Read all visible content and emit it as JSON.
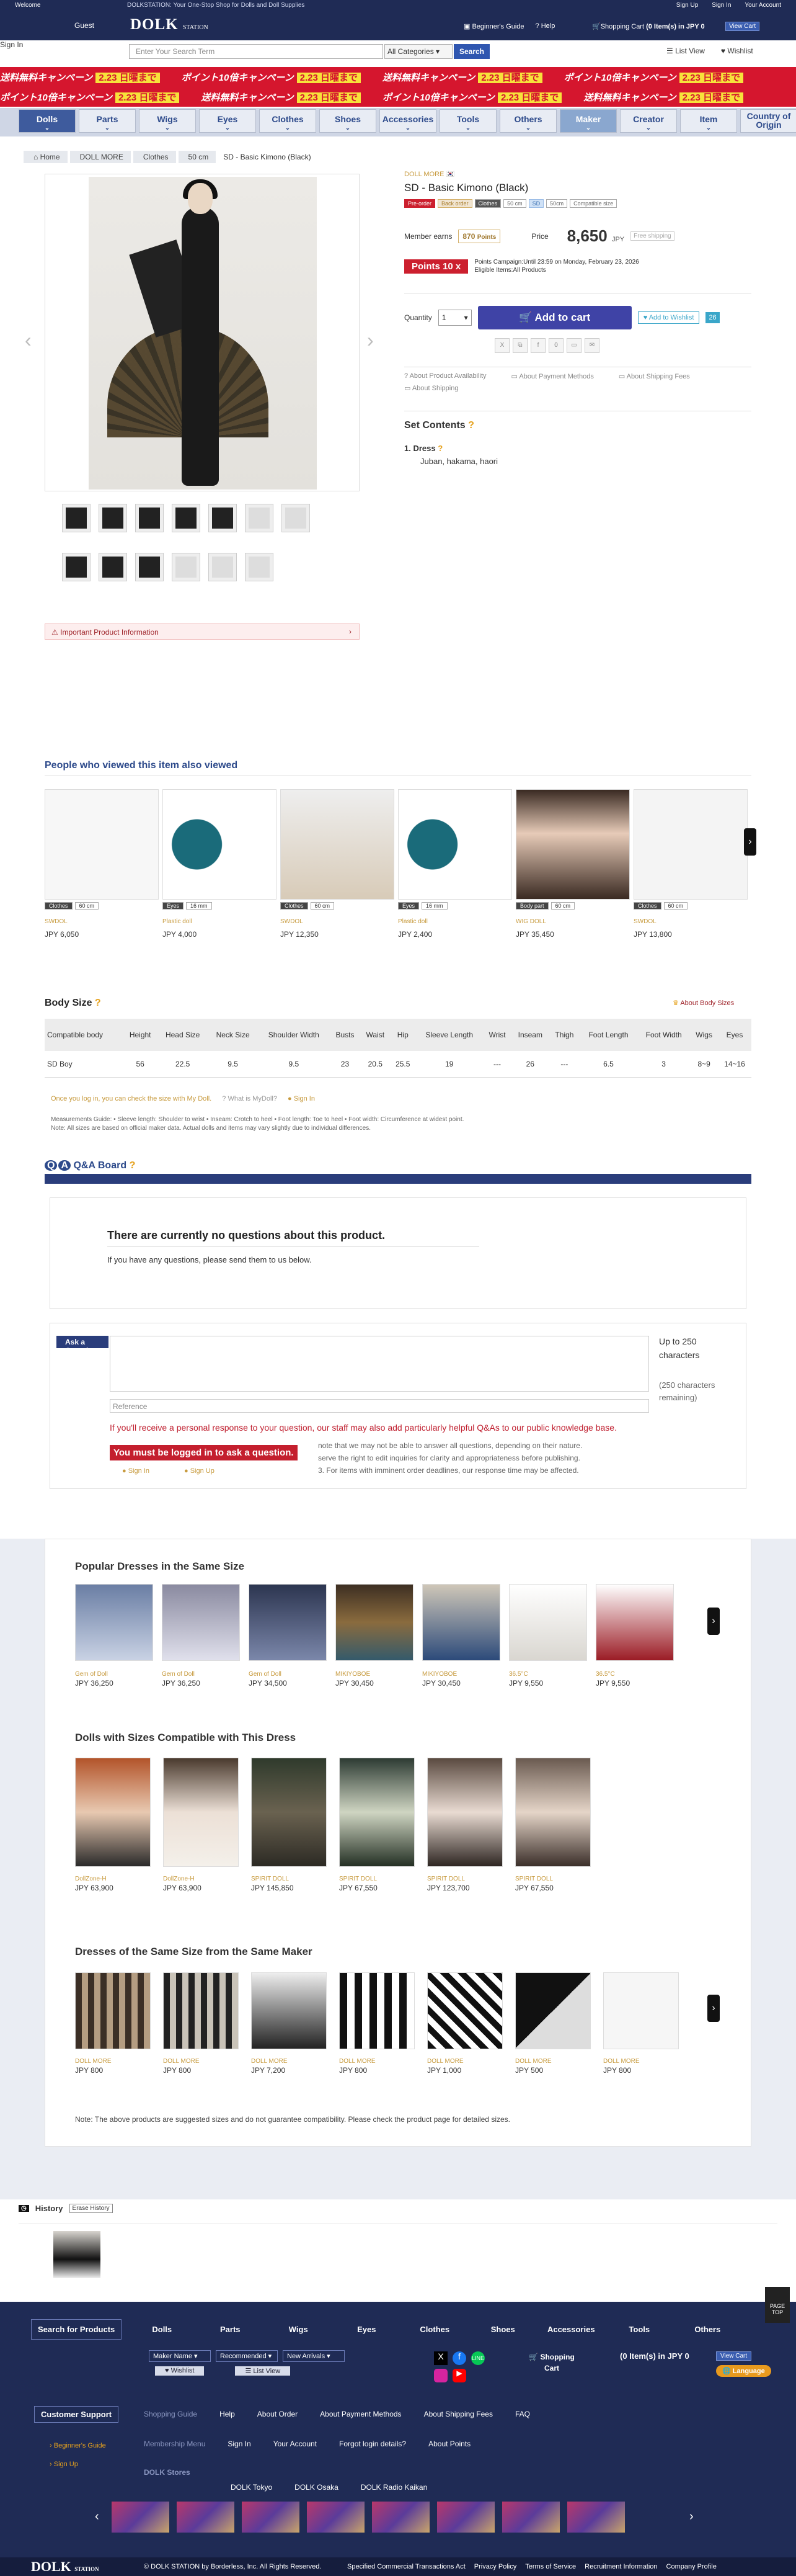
{
  "header": {
    "welcome": "Welcome",
    "tagline": "DOLKSTATION: Your One-Stop Shop for Dolls and Doll Supplies",
    "guest": "Guest",
    "signin": "Sign In",
    "logo": "DOLK",
    "logo_sub": "STATION",
    "toplinks": [
      "Sign Up",
      "Sign In",
      "Your Account"
    ],
    "guide": "Beginner's Guide",
    "help": "Help",
    "cart_label": "Shopping Cart",
    "cart_info": "(0 Item(s) in JPY 0",
    "view_cart": "View Cart"
  },
  "search": {
    "placeholder": "Enter Your Search Term",
    "category": "All Categories",
    "button": "Search",
    "list_view": "List View",
    "wishlist": "Wishlist"
  },
  "campaign": {
    "text1": "送料無料",
    "text2": "キャンペーン",
    "text3": "ポイント10倍",
    "date": "2.23 日曜まで"
  },
  "nav": [
    "Dolls",
    "Parts",
    "Wigs",
    "Eyes",
    "Clothes",
    "Shoes",
    "Accessories",
    "Tools",
    "Others",
    "Maker",
    "Creator",
    "Item",
    "Country of Origin"
  ],
  "breadcrumb": [
    "Home",
    "DOLL MORE",
    "Clothes",
    "50 cm",
    "SD - Basic Kimono (Black)"
  ],
  "important": "Important Product Information",
  "product": {
    "maker": "DOLL MORE",
    "title": "SD - Basic Kimono (Black)",
    "tags": [
      "Pre-order",
      "Back order",
      "Clothes",
      "50 cm",
      "SD",
      "50cm",
      "Compatible size"
    ],
    "member_earns": "Member earns",
    "points": "870",
    "points_label": "Points",
    "price_label": "Price",
    "price": "8,650",
    "currency": "JPY",
    "free_ship": "Free shipping",
    "bonus": "Points 10 x",
    "bonus_text1": "Points Campaign:Until 23:59 on Monday, February 23, 2026",
    "bonus_text2": "Eligible Items:All Products",
    "qty_label": "Quantity",
    "qty": "1",
    "add_cart": "Add to cart",
    "add_wish": "Add to Wishlist",
    "wish_count": "26",
    "help": [
      "About Product Availability",
      "About Payment Methods",
      "About Shipping Fees",
      "About Shipping"
    ],
    "set_title": "Set Contents",
    "set_item": "1. Dress",
    "set_desc": "Juban, hakama, haori"
  },
  "viewed": {
    "title": "People who viewed this item also viewed",
    "items": [
      {
        "cat": "Clothes",
        "size": "60 cm",
        "maker": "SWDOL",
        "price": "JPY 6,050"
      },
      {
        "cat": "Eyes",
        "size": "16 mm",
        "maker": "Plastic doll",
        "price": "JPY 4,000"
      },
      {
        "cat": "Clothes",
        "size": "60 cm",
        "maker": "SWDOL",
        "price": "JPY 12,350"
      },
      {
        "cat": "Eyes",
        "size": "16 mm",
        "maker": "Plastic doll",
        "price": "JPY 2,400"
      },
      {
        "cat": "Body part",
        "size": "60 cm",
        "maker": "WIG DOLL",
        "price": "JPY 35,450"
      },
      {
        "cat": "Clothes",
        "size": "60 cm",
        "maker": "SWDOL",
        "price": "JPY 13,800"
      }
    ]
  },
  "bodysize": {
    "title": "Body Size",
    "about": "About Body Sizes",
    "headers": [
      "Compatible body",
      "Height",
      "Head Size",
      "Neck Size",
      "Shoulder Width",
      "Busts",
      "Waist",
      "Hip",
      "Sleeve Length",
      "Wrist",
      "Inseam",
      "Thigh",
      "Foot Length",
      "Foot Width",
      "Wigs",
      "Eyes"
    ],
    "row": [
      "SD Boy",
      "56",
      "22.5",
      "9.5",
      "9.5",
      "23",
      "20.5",
      "25.5",
      "19",
      "---",
      "26",
      "---",
      "6.5",
      "3",
      "8~9",
      "14~16"
    ],
    "note1": "Once you log in, you can check the size with My Doll.",
    "note_mydoll": "What is MyDoll?",
    "note_signin": "Sign In",
    "meas": "Measurements Guide: • Sleeve length: Shoulder to wrist • Inseam: Crotch to heel • Foot length: Toe to heel • Foot width: Circumference at widest point.",
    "meas2": "Note: All sizes are based on official maker data. Actual dolls and items may vary slightly due to individual differences."
  },
  "qa": {
    "title": "Q&A Board",
    "none": "There are currently no questions about this product.",
    "none_sub": "If you have any questions, please send them to us below.",
    "ask": "Ask a Question",
    "limit": "Up to 250 characters",
    "remaining": "(250 characters remaining)",
    "ref": "Reference",
    "notice": "If you'll receive a personal response to your question, our staff may also add particularly helpful Q&As to our public knowledge base.",
    "login": "You must be logged in to ask a question.",
    "note2": "note that we may not be able to answer all questions, depending on their nature.",
    "note3": "serve the right to edit inquiries for clarity and appropriateness before publishing.",
    "note4": "3. For items with imminent order deadlines, our response time may be affected.",
    "signin": "Sign In",
    "signup": "Sign Up"
  },
  "popular": {
    "title": "Popular Dresses in the Same Size",
    "items": [
      {
        "maker": "Gem of Doll",
        "price": "JPY 36,250"
      },
      {
        "maker": "Gem of Doll",
        "price": "JPY 36,250"
      },
      {
        "maker": "Gem of Doll",
        "price": "JPY 34,500"
      },
      {
        "maker": "MIKIYOBOE",
        "price": "JPY 30,450"
      },
      {
        "maker": "MIKIYOBOE",
        "price": "JPY 30,450"
      },
      {
        "maker": "36.5°C",
        "price": "JPY 9,550"
      },
      {
        "maker": "36.5°C",
        "price": "JPY 9,550"
      }
    ]
  },
  "compatible": {
    "title": "Dolls with Sizes Compatible with This Dress",
    "items": [
      {
        "maker": "DollZone-H",
        "price": "JPY 63,900"
      },
      {
        "maker": "DollZone-H",
        "price": "JPY 63,900"
      },
      {
        "maker": "SPIRIT DOLL",
        "price": "JPY 145,850"
      },
      {
        "maker": "SPIRIT DOLL",
        "price": "JPY 67,550"
      },
      {
        "maker": "SPIRIT DOLL",
        "price": "JPY 123,700"
      },
      {
        "maker": "SPIRIT DOLL",
        "price": "JPY 67,550"
      }
    ]
  },
  "samemaker": {
    "title": "Dresses of the Same Size from the Same Maker",
    "items": [
      {
        "maker": "DOLL MORE",
        "price": "JPY 800"
      },
      {
        "maker": "DOLL MORE",
        "price": "JPY 800"
      },
      {
        "maker": "DOLL MORE",
        "price": "JPY 7,200"
      },
      {
        "maker": "DOLL MORE",
        "price": "JPY 800"
      },
      {
        "maker": "DOLL MORE",
        "price": "JPY 1,000"
      },
      {
        "maker": "DOLL MORE",
        "price": "JPY 500"
      },
      {
        "maker": "DOLL MORE",
        "price": "JPY 800"
      }
    ]
  },
  "note_bottom": "Note: The above products are suggested sizes and do not guarantee compatibility. Please check the product page for detailed sizes.",
  "history": {
    "title": "History",
    "erase": "Erase History"
  },
  "footer": {
    "search_label": "Search for Products",
    "menu": [
      "Dolls",
      "Parts",
      "Wigs",
      "Eyes",
      "Clothes",
      "Shoes",
      "Accessories",
      "Tools",
      "Others"
    ],
    "maker": "Maker Name",
    "recommended": "Recommended",
    "new": "New Arrivals",
    "wishlist": "Wishlist",
    "listview": "List View",
    "cart": "Shopping Cart",
    "cart_info": "(0 Item(s) in JPY 0",
    "view_cart": "View Cart",
    "language": "Language",
    "support": "Customer Support",
    "beginner": "Beginner's Guide",
    "signup": "Sign Up",
    "guide_links": [
      "Shopping Guide",
      "Help",
      "About Order",
      "About Payment Methods",
      "About Shipping Fees",
      "FAQ"
    ],
    "member_label": "Membership Menu",
    "member_links": [
      "Sign In",
      "Your Account",
      "Forgot login details?",
      "About Points"
    ],
    "stores_label": "DOLK Stores",
    "stores": [
      "DOLK Tokyo",
      "DOLK Osaka",
      "DOLK Radio Kaikan"
    ],
    "copyright": "© DOLK STATION by Borderless, Inc. All Rights Reserved.",
    "bottom_links": [
      "Specified Commercial Transactions Act",
      "Privacy Policy",
      "Terms of Service",
      "Recruitment Information",
      "Company Profile"
    ],
    "pagetop": "PAGE TOP"
  }
}
